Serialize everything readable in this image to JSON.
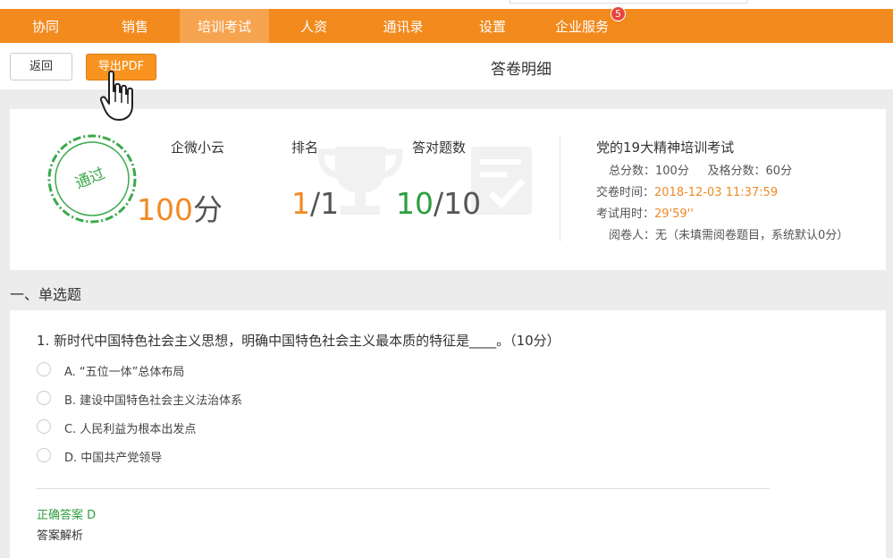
{
  "nav": {
    "items": [
      {
        "label": "协同"
      },
      {
        "label": "销售"
      },
      {
        "label": "培训考试"
      },
      {
        "label": "人资"
      },
      {
        "label": "通讯录"
      },
      {
        "label": "设置"
      },
      {
        "label": "企业服务"
      }
    ],
    "active_index": 2,
    "badge_count": "5",
    "bar_color": "#f28a1e"
  },
  "toolbar": {
    "back_label": "返回",
    "export_label": "导出PDF",
    "title": "答卷明细"
  },
  "summary": {
    "stamp_text": "通过",
    "user_name": "企微小云",
    "score_value": "100",
    "score_unit": "分",
    "rank_label": "排名",
    "rank_value": "1",
    "rank_total": "/1",
    "correct_label": "答对题数",
    "correct_value": "10",
    "correct_total": "/10"
  },
  "exam": {
    "title": "党的19大精神培训考试",
    "total_label": "总分数：",
    "total_value": "100分",
    "pass_label": "及格分数：",
    "pass_value": "60分",
    "submit_label": "交卷时间：",
    "submit_value": "2018-12-03 11:37:59",
    "duration_label": "考试用时：",
    "duration_value": "29'59''",
    "grader_label": "阅卷人：",
    "grader_value": "无（未填需阅卷题目，系统默认0分）"
  },
  "section": {
    "title": "一、单选题"
  },
  "question": {
    "text": "1. 新时代中国特色社会主义思想，明确中国特色社会主义最本质的特征是____。（10分）",
    "options": [
      {
        "label": "A. “五位一体”总体布局"
      },
      {
        "label": "B. 建设中国特色社会主义法治体系"
      },
      {
        "label": "C. 人民利益为根本出发点"
      },
      {
        "label": "D. 中国共产党领导"
      }
    ],
    "answer_label": "正确答案 D",
    "analysis_label": "答案解析"
  },
  "colors": {
    "accent": "#f28a1e",
    "pass_green": "#3aa94a",
    "score_orange": "#f08a25"
  }
}
